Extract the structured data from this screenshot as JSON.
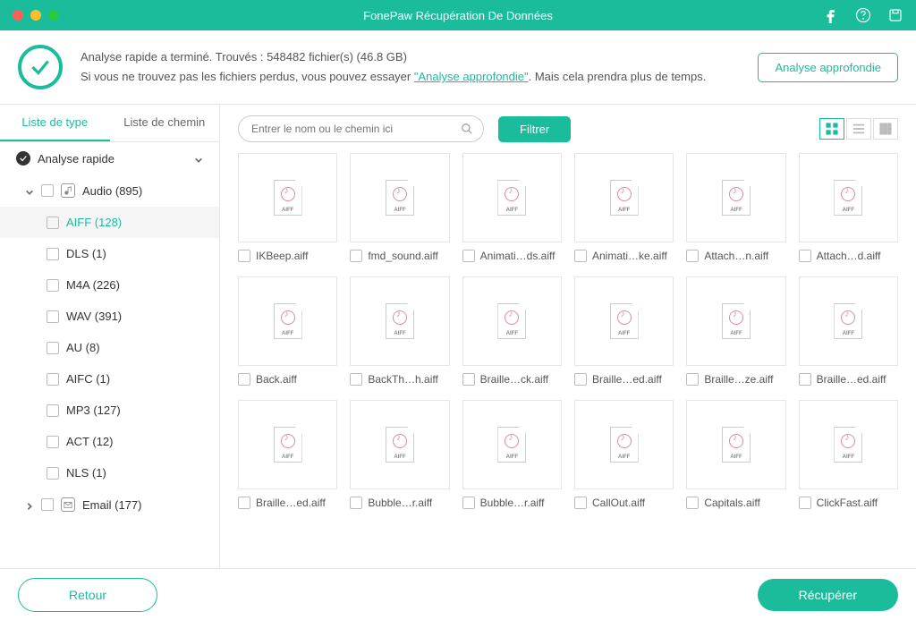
{
  "titlebar": {
    "title": "FonePaw Récupération De Données"
  },
  "banner": {
    "line1": "Analyse rapide a terminé. Trouvés : 548482 fichier(s) (46.8 GB)",
    "line2_before": "Si vous ne trouvez pas les fichiers perdus, vous pouvez essayer ",
    "line2_link": "\"Analyse approfondie\"",
    "line2_after": ". Mais cela prendra plus de temps.",
    "deep_scan": "Analyse approfondie"
  },
  "sidebar": {
    "tabs": {
      "type": "Liste de type",
      "path": "Liste de chemin"
    },
    "quick_scan": "Analyse rapide",
    "categories": [
      {
        "label": "Audio (895)",
        "items": [
          {
            "label": "AIFF (128)"
          },
          {
            "label": "DLS (1)"
          },
          {
            "label": "M4A (226)"
          },
          {
            "label": "WAV (391)"
          },
          {
            "label": "AU (8)"
          },
          {
            "label": "AIFC (1)"
          },
          {
            "label": "MP3 (127)"
          },
          {
            "label": "ACT (12)"
          },
          {
            "label": "NLS (1)"
          }
        ]
      },
      {
        "label": "Email (177)"
      }
    ]
  },
  "toolbar": {
    "search_placeholder": "Entrer le nom ou le chemin ici",
    "filter": "Filtrer"
  },
  "files": [
    {
      "name": "IKBeep.aiff"
    },
    {
      "name": "fmd_sound.aiff"
    },
    {
      "name": "Animati…ds.aiff"
    },
    {
      "name": "Animati…ke.aiff"
    },
    {
      "name": "Attach…n.aiff"
    },
    {
      "name": "Attach…d.aiff"
    },
    {
      "name": "Back.aiff"
    },
    {
      "name": "BackTh…h.aiff"
    },
    {
      "name": "Braille…ck.aiff"
    },
    {
      "name": "Braille…ed.aiff"
    },
    {
      "name": "Braille…ze.aiff"
    },
    {
      "name": "Braille…ed.aiff"
    },
    {
      "name": "Braille…ed.aiff"
    },
    {
      "name": "Bubble…r.aiff"
    },
    {
      "name": "Bubble…r.aiff"
    },
    {
      "name": "CallOut.aiff"
    },
    {
      "name": "Capitals.aiff"
    },
    {
      "name": "ClickFast.aiff"
    }
  ],
  "footer": {
    "back": "Retour",
    "recover": "Récupérer"
  }
}
